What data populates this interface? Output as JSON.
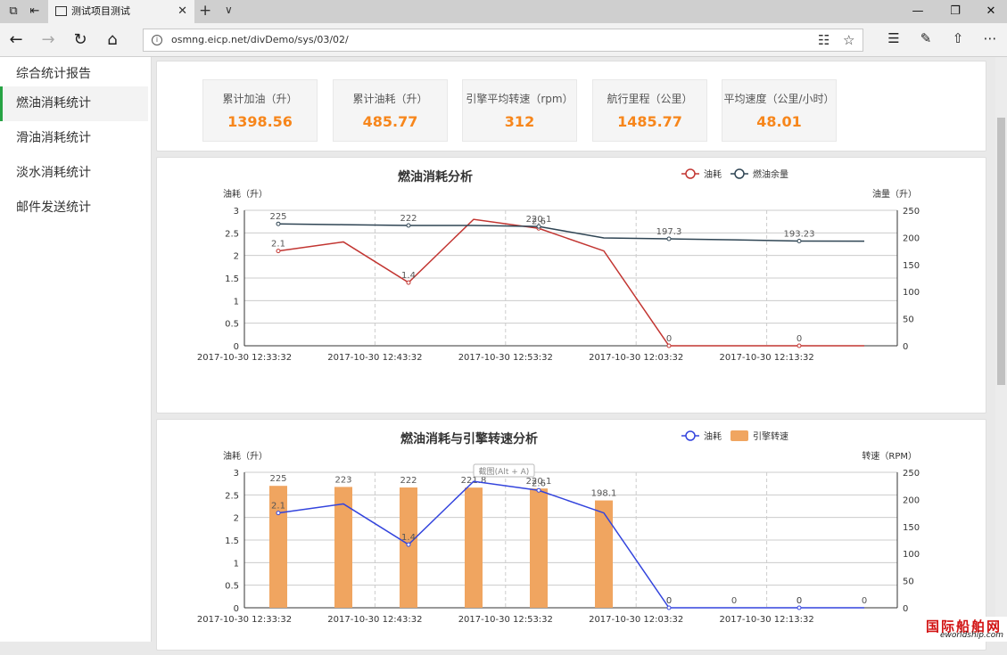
{
  "browser": {
    "tab_title": "测试项目测试",
    "url": "osmng.eicp.net/divDemo/sys/03/02/"
  },
  "sidebar": {
    "items": [
      {
        "label": "综合统计报告",
        "active": false
      },
      {
        "label": "燃油消耗统计",
        "active": true
      },
      {
        "label": "滑油消耗统计",
        "active": false
      },
      {
        "label": "淡水消耗统计",
        "active": false
      },
      {
        "label": "邮件发送统计",
        "active": false
      }
    ]
  },
  "stats": [
    {
      "label": "累计加油（升）",
      "value": "1398.56"
    },
    {
      "label": "累计油耗（升）",
      "value": "485.77"
    },
    {
      "label": "引擎平均转速（rpm）",
      "value": "312"
    },
    {
      "label": "航行里程（公里）",
      "value": "1485.77"
    },
    {
      "label": "平均速度（公里/小时）",
      "value": "48.01"
    }
  ],
  "colors": {
    "accent": "#f7861b",
    "active": "#27a344",
    "fuel_line": "#c23531",
    "remain_line": "#2f4554",
    "rpm_line": "#3344dd",
    "rpm_bar": "#f0a560"
  },
  "chart_data": [
    {
      "type": "line",
      "title": "燃油消耗分析",
      "legend": [
        "油耗",
        "燃油余量"
      ],
      "legend_position": "top-right",
      "ylabel_left": "油耗（升）",
      "ylabel_right": "油量（升）",
      "x_ticks": [
        "2017-10-30 12:33:32",
        "2017-10-30 12:43:32",
        "2017-10-30 12:53:32",
        "2017-10-30 12:03:32",
        "2017-10-30 12:13:32"
      ],
      "y_left_ticks": [
        "0",
        "0.5",
        "1",
        "1.5",
        "2",
        "2.5",
        "3"
      ],
      "y_right_ticks": [
        "0",
        "50",
        "100",
        "150",
        "200",
        "250"
      ],
      "ylim_left": [
        0,
        3
      ],
      "ylim_right": [
        0,
        250
      ],
      "series": [
        {
          "name": "油耗",
          "axis": "left",
          "values": [
            2.1,
            2.3,
            1.4,
            2.8,
            2.6,
            2.1,
            0,
            0,
            0,
            0
          ],
          "labels": {
            "0": "2.1",
            "2": "1.4",
            "4": "2.6",
            "6": "0",
            "8": "0"
          }
        },
        {
          "name": "燃油余量",
          "axis": "right",
          "values": [
            225,
            223.5,
            222,
            222,
            220.1,
            199,
            197.3,
            195.5,
            193.23,
            193
          ],
          "labels": {
            "0": "225",
            "2": "222",
            "4": "220.1",
            "6": "197.3",
            "8": "193.23"
          }
        }
      ]
    },
    {
      "type": "bar",
      "title": "燃油消耗与引擎转速分析",
      "legend": [
        "油耗",
        "引擎转速"
      ],
      "legend_position": "top-right",
      "ylabel_left": "油耗（升）",
      "ylabel_right": "转速（RPM）",
      "tooltip": "截图(Alt + A)",
      "x_ticks": [
        "2017-10-30 12:33:32",
        "2017-10-30 12:43:32",
        "2017-10-30 12:53:32",
        "2017-10-30 12:03:32",
        "2017-10-30 12:13:32"
      ],
      "y_left_ticks": [
        "0",
        "0.5",
        "1",
        "1.5",
        "2",
        "2.5",
        "3"
      ],
      "y_right_ticks": [
        "0",
        "50",
        "100",
        "150",
        "200",
        "250"
      ],
      "ylim_left": [
        0,
        3
      ],
      "ylim_right": [
        0,
        250
      ],
      "series": [
        {
          "name": "引擎转速",
          "axis": "right",
          "kind": "bar",
          "values": [
            225,
            223,
            222,
            221.8,
            220.1,
            198.1,
            0,
            0,
            0,
            0
          ],
          "labels": {
            "0": "225",
            "1": "223",
            "2": "222",
            "3": "221.8",
            "4": "220.1",
            "5": "198.1",
            "6": "0",
            "7": "0",
            "8": "0",
            "9": "0"
          }
        },
        {
          "name": "油耗",
          "axis": "left",
          "kind": "line",
          "values": [
            2.1,
            2.3,
            1.4,
            2.8,
            2.6,
            2.1,
            0,
            0,
            0,
            0
          ],
          "labels": {
            "0": "2.1",
            "2": "1.4",
            "4": "2.6",
            "6": "0",
            "8": "0"
          }
        }
      ]
    }
  ]
}
